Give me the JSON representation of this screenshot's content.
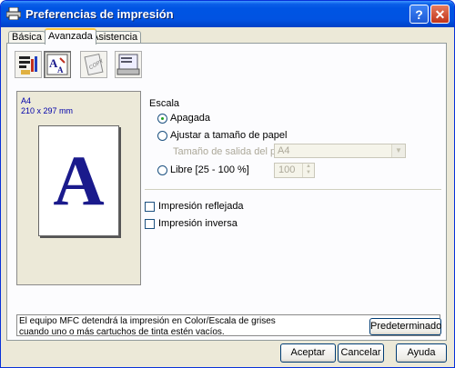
{
  "window": {
    "title": "Preferencias de impresión",
    "help_label": "?",
    "close_label": "✕"
  },
  "tabs": [
    {
      "label": "Básica"
    },
    {
      "label": "Avanzada"
    },
    {
      "label": "Asistencia"
    }
  ],
  "toolbar_icons": [
    "print-quality-icon",
    "scaling-icon",
    "copy-icon",
    "watermark-icon"
  ],
  "preview": {
    "paper_name": "A4",
    "paper_dims": "210 x 297 mm",
    "page_glyph": "A"
  },
  "scaling": {
    "section_label": "Escala",
    "options": [
      {
        "label": "Apagada",
        "selected": true
      },
      {
        "label": "Ajustar a tamaño de papel",
        "selected": false
      },
      {
        "label": "Libre [25 - 100 %]",
        "selected": false
      }
    ],
    "output_size_label": "Tamaño de salida del papel",
    "output_size_value": "A4",
    "free_value": "100"
  },
  "options": {
    "mirror_label": "Impresión reflejada",
    "mirror_checked": false,
    "reverse_label": "Impresión inversa",
    "reverse_checked": false
  },
  "info_message": "El equipo MFC detendrá la impresión en Color/Escala de grises cuando uno o más cartuchos de tinta estén vacíos.",
  "buttons": {
    "default_label": "Predeterminado",
    "ok_label": "Aceptar",
    "cancel_label": "Cancelar",
    "help_label": "Ayuda"
  },
  "colors": {
    "titlebar": "#0054e3",
    "dialog_bg": "#ece9d8",
    "tab_highlight": "#ffc83c",
    "preview_text": "#0000aa"
  }
}
